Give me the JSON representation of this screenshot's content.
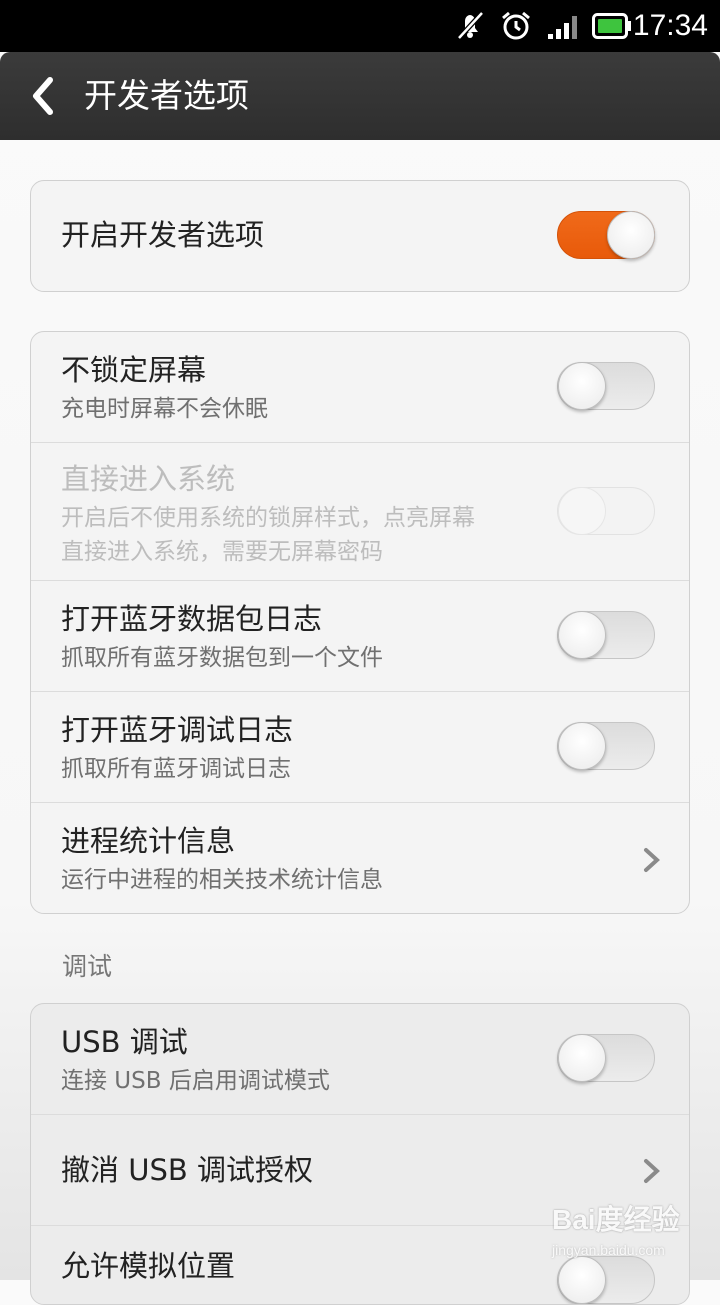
{
  "status_bar": {
    "time": "17:34",
    "icons": [
      "notification-off-icon",
      "alarm-icon",
      "signal-icon",
      "battery-icon"
    ],
    "battery_color": "#3ec43e"
  },
  "title_bar": {
    "title": "开发者选项",
    "back_icon": "back-arrow-icon"
  },
  "master": {
    "title": "开启开发者选项",
    "enabled": true
  },
  "group1": [
    {
      "title": "不锁定屏幕",
      "subtitle": "充电时屏幕不会休眠",
      "control": "toggle",
      "on": false,
      "disabled": false
    },
    {
      "title": "直接进入系统",
      "subtitle_line1": "开启后不使用系统的锁屏样式，点亮屏幕",
      "subtitle_line2": "直接进入系统，需要无屏幕密码",
      "control": "toggle",
      "on": false,
      "disabled": true
    },
    {
      "title": "打开蓝牙数据包日志",
      "subtitle": "抓取所有蓝牙数据包到一个文件",
      "control": "toggle",
      "on": false,
      "disabled": false
    },
    {
      "title": "打开蓝牙调试日志",
      "subtitle": "抓取所有蓝牙调试日志",
      "control": "toggle",
      "on": false,
      "disabled": false
    },
    {
      "title": "进程统计信息",
      "subtitle": "运行中进程的相关技术统计信息",
      "control": "chevron"
    }
  ],
  "debug_section": {
    "header": "调试",
    "items": [
      {
        "title": "USB 调试",
        "subtitle": "连接 USB 后启用调试模式",
        "control": "toggle",
        "on": false
      },
      {
        "title": "撤消 USB 调试授权",
        "control": "chevron"
      },
      {
        "title": "允许模拟位置",
        "control": "toggle",
        "on": false
      }
    ]
  },
  "colors": {
    "accent": "#ef6515",
    "title_bar_bg": "#333333",
    "card_bg": "#f4f4f4"
  },
  "watermark": {
    "main": "Bai度经验",
    "sub": "jingyan.baidu.com"
  }
}
